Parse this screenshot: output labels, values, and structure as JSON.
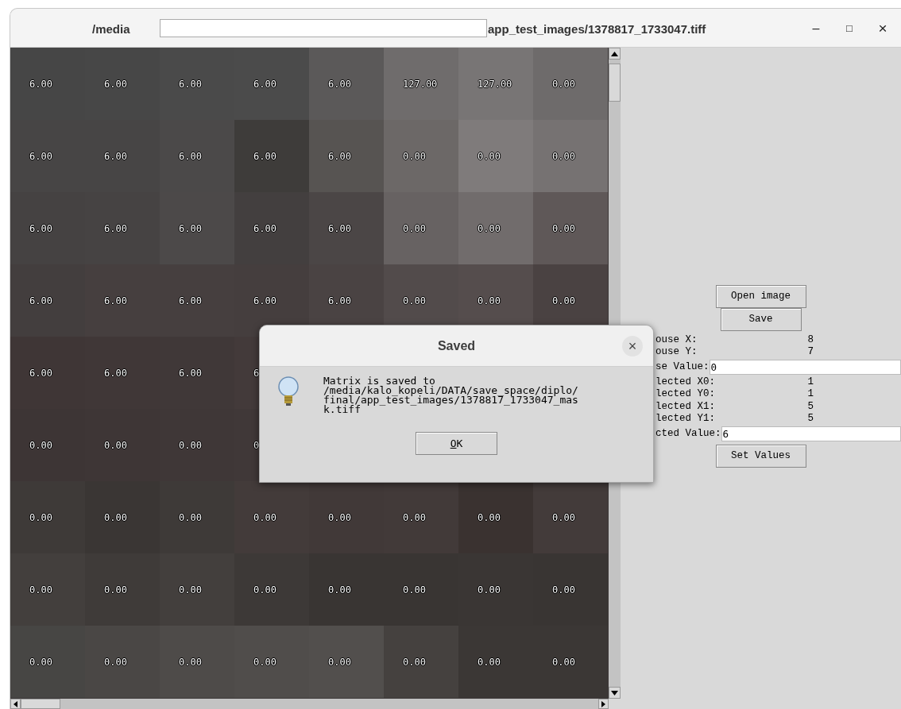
{
  "window": {
    "title_start": "/media",
    "title_end": "app_test_images/1378817_1733047.tiff",
    "controls": [
      {
        "kind": "minimize",
        "glyph": "–"
      },
      {
        "kind": "maximize",
        "glyph": "□"
      },
      {
        "kind": "close",
        "glyph": "×"
      }
    ]
  },
  "matrix": {
    "rows": [
      {
        "cells": [
          {
            "value": "6.00",
            "color": "#464646"
          },
          {
            "value": "6.00",
            "color": "#474747"
          },
          {
            "value": "6.00",
            "color": "#4a4a4a"
          },
          {
            "value": "6.00",
            "color": "#4b4b4b"
          },
          {
            "value": "6.00",
            "color": "#5b5959"
          },
          {
            "value": "127.00",
            "color": "#6f6c6c"
          },
          {
            "value": "127.00",
            "color": "#787575"
          },
          {
            "value": "0.00",
            "color": "#6e6b6b"
          }
        ]
      },
      {
        "cells": [
          {
            "value": "6.00",
            "color": "#474545"
          },
          {
            "value": "6.00",
            "color": "#474545"
          },
          {
            "value": "6.00",
            "color": "#4b4949"
          },
          {
            "value": "6.00",
            "color": "#3e3c3a"
          },
          {
            "value": "6.00",
            "color": "#575452"
          },
          {
            "value": "0.00",
            "color": "#6c6867"
          },
          {
            "value": "0.00",
            "color": "#7f7b7b"
          },
          {
            "value": "0.00",
            "color": "#767272"
          }
        ]
      },
      {
        "cells": [
          {
            "value": "6.00",
            "color": "#454242"
          },
          {
            "value": "6.00",
            "color": "#464343"
          },
          {
            "value": "6.00",
            "color": "#4c4949"
          },
          {
            "value": "6.00",
            "color": "#433f3f"
          },
          {
            "value": "6.00",
            "color": "#4b4646"
          },
          {
            "value": "0.00",
            "color": "#676262"
          },
          {
            "value": "0.00",
            "color": "#716c6c"
          },
          {
            "value": "0.00",
            "color": "#5f5858"
          }
        ]
      },
      {
        "cells": [
          {
            "value": "6.00",
            "color": "#433e3e"
          },
          {
            "value": "6.00",
            "color": "#463f3f"
          },
          {
            "value": "6.00",
            "color": "#463f3f"
          },
          {
            "value": "6.00",
            "color": "#453e3e"
          },
          {
            "value": "6.00",
            "color": "#4a4343"
          },
          {
            "value": "0.00",
            "color": "#524b4b"
          },
          {
            "value": "0.00",
            "color": "#554d4d"
          },
          {
            "value": "0.00",
            "color": "#4a4242"
          }
        ]
      },
      {
        "cells": [
          {
            "value": "6.00",
            "color": "#3f3636"
          },
          {
            "value": "6.00",
            "color": "#403737"
          },
          {
            "value": "6.00",
            "color": "#403838"
          },
          {
            "value": "6",
            "color": "#433a3a"
          }
        ]
      },
      {
        "cells": [
          {
            "value": "0.00",
            "color": "#3d3535"
          },
          {
            "value": "0.00",
            "color": "#3e3636"
          },
          {
            "value": "0.00",
            "color": "#3f3737"
          },
          {
            "value": "0",
            "color": "#403838"
          }
        ]
      },
      {
        "cells": [
          {
            "value": "0.00",
            "color": "#3e3a38"
          },
          {
            "value": "0.00",
            "color": "#3a3634"
          },
          {
            "value": "0.00",
            "color": "#3e3a38"
          },
          {
            "value": "0.00",
            "color": "#433b3a"
          },
          {
            "value": "0.00",
            "color": "#413938"
          },
          {
            "value": "0.00",
            "color": "#423a39"
          },
          {
            "value": "0.00",
            "color": "#3a3230"
          },
          {
            "value": "0.00",
            "color": "#433b3a"
          }
        ]
      },
      {
        "cells": [
          {
            "value": "0.00",
            "color": "#433f3d"
          },
          {
            "value": "0.00",
            "color": "#3f3b39"
          },
          {
            "value": "0.00",
            "color": "#433f3d"
          },
          {
            "value": "0.00",
            "color": "#3d3937"
          },
          {
            "value": "0.00",
            "color": "#393533"
          },
          {
            "value": "0.00",
            "color": "#393533"
          },
          {
            "value": "0.00",
            "color": "#3a3634"
          },
          {
            "value": "0.00",
            "color": "#393533"
          }
        ]
      },
      {
        "cells": [
          {
            "value": "0.00",
            "color": "#474644"
          },
          {
            "value": "0.00",
            "color": "#4a4745"
          },
          {
            "value": "0.00",
            "color": "#4e4b49"
          },
          {
            "value": "0.00",
            "color": "#504d4b"
          },
          {
            "value": "0.00",
            "color": "#524f4d"
          },
          {
            "value": "0.00",
            "color": "#45413f"
          },
          {
            "value": "0.00",
            "color": "#3b3735"
          },
          {
            "value": "0.00",
            "color": "#3b3735"
          }
        ]
      }
    ]
  },
  "panel": {
    "buttons": [
      "Open image",
      "Save"
    ],
    "readouts": [
      {
        "kind": "label",
        "label": "ouse X:",
        "value": "8"
      },
      {
        "kind": "label",
        "label": "ouse Y:",
        "value": "7"
      },
      {
        "kind": "entry",
        "label": "se Value:",
        "value": "0"
      },
      {
        "kind": "label",
        "label": "lected X0:",
        "value": "1"
      },
      {
        "kind": "label",
        "label": "lected Y0:",
        "value": "1"
      },
      {
        "kind": "label",
        "label": "lected X1:",
        "value": "5"
      },
      {
        "kind": "label",
        "label": "lected Y1:",
        "value": "5"
      },
      {
        "kind": "entry",
        "label": "cted Value:",
        "value": "6"
      }
    ],
    "action_button": "Set Values"
  },
  "dialog": {
    "title": "Saved",
    "close": "×",
    "message_lines": [
      "Matrix is saved to",
      "/media/kalo_kopeli/DATA/save_space/diplo/",
      "final/app_test_images/1378817_1733047_mas",
      "k.tiff"
    ],
    "button": "OK"
  }
}
